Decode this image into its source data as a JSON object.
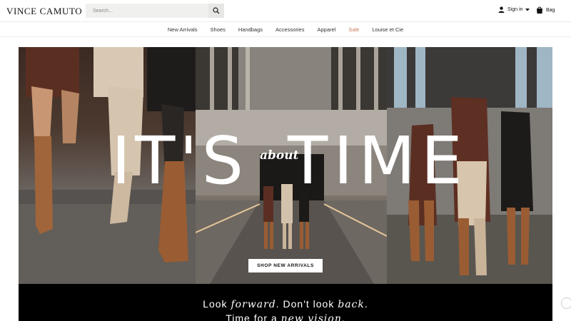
{
  "header": {
    "logo": "VINCE CAMUTO",
    "search": {
      "placeholder": "Search..."
    },
    "sign_in_label": "Sign in",
    "bag_label": "Bag"
  },
  "nav": {
    "items": [
      {
        "label": "New Arrivals"
      },
      {
        "label": "Shoes"
      },
      {
        "label": "Handbags"
      },
      {
        "label": "Accessories"
      },
      {
        "label": "Apparel"
      },
      {
        "label": "Sale"
      },
      {
        "label": "Louise et Cie"
      }
    ]
  },
  "hero": {
    "headline_left": "IT'S",
    "headline_about": "about",
    "headline_right": "TIME",
    "cta_label": "SHOP NEW ARRIVALS"
  },
  "banner": {
    "line1": {
      "p1": "Look ",
      "p2": "forward",
      "p3": ". Don't look ",
      "p4": "back",
      "p5": "."
    },
    "line2": {
      "p1": "Time for a ",
      "p2": "new vision",
      "p3": "."
    }
  },
  "colors": {
    "sale": "#c7795c",
    "banner_bg": "#000000"
  }
}
